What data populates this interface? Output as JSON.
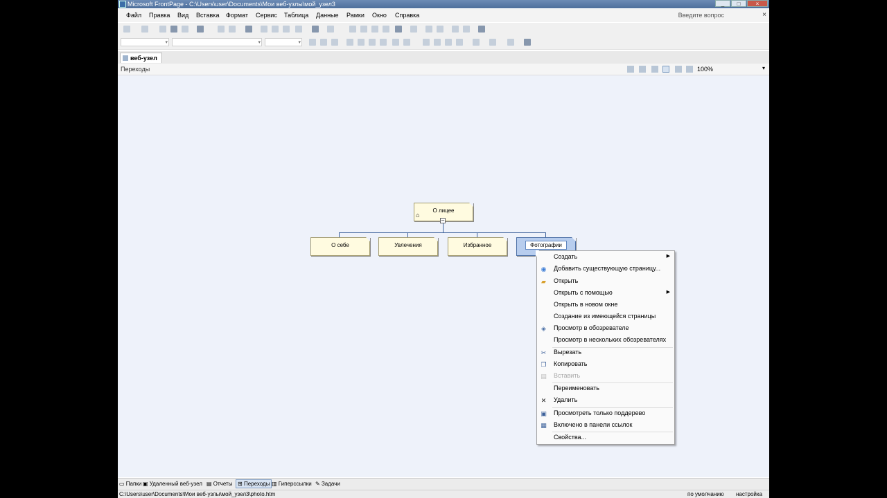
{
  "window": {
    "title": "Microsoft FrontPage - C:\\Users\\user\\Documents\\Мои веб-узлы\\мой_узел3"
  },
  "menu": {
    "items": [
      "Файл",
      "Правка",
      "Вид",
      "Вставка",
      "Формат",
      "Сервис",
      "Таблица",
      "Данные",
      "Рамки",
      "Окно",
      "Справка"
    ],
    "help_placeholder": "Введите вопрос"
  },
  "tab": {
    "label": "веб-узел"
  },
  "view": {
    "label": "Переходы",
    "zoom": "100%"
  },
  "navigation": {
    "root": "О лицее",
    "children": [
      "О себе",
      "Увлечения",
      "Избранное",
      "Фотографии"
    ],
    "selected": "Фотографии"
  },
  "context_menu": {
    "items": [
      {
        "label": "Создать",
        "icon": "none",
        "submenu": true
      },
      {
        "label": "Добавить существующую страницу...",
        "icon": "globe-icon"
      },
      {
        "label": "Открыть",
        "icon": "folder-open-icon"
      },
      {
        "label": "Открыть с помощью",
        "icon": "none",
        "submenu": true
      },
      {
        "label": "Открыть в новом окне",
        "icon": "none"
      },
      {
        "label": "Создание из имеющейся страницы",
        "icon": "none"
      },
      {
        "label": "Просмотр в обозревателе",
        "icon": "preview-icon"
      },
      {
        "label": "Просмотр в нескольких обозревателях",
        "icon": "none"
      },
      {
        "label": "Вырезать",
        "icon": "scissors-icon"
      },
      {
        "label": "Копировать",
        "icon": "copy-icon"
      },
      {
        "label": "Вставить",
        "icon": "paste-icon",
        "disabled": true
      },
      {
        "label": "Переименовать",
        "icon": "none"
      },
      {
        "label": "Удалить",
        "icon": "delete-icon"
      },
      {
        "label": "Просмотреть только поддерево",
        "icon": "subtree-icon"
      },
      {
        "label": "Включено в панели ссылок",
        "icon": "link-bar-icon"
      },
      {
        "label": "Свойства...",
        "icon": "none"
      }
    ]
  },
  "views_bar": {
    "items": [
      "Папки",
      "Удаленный веб-узел",
      "Отчеты",
      "Переходы",
      "Гиперссылки",
      "Задачи"
    ],
    "active": "Переходы"
  },
  "status": {
    "path": "C:\\Users\\user\\Documents\\Мои веб-узлы\\мой_узел3\\photo.htm",
    "right1": "по умолчанию",
    "right2": "настройка"
  },
  "colors": {
    "canvas": "#eef2fa",
    "node": "#fffbe0",
    "selected_node": "#b7cdee",
    "connector": "#3a5f99"
  }
}
